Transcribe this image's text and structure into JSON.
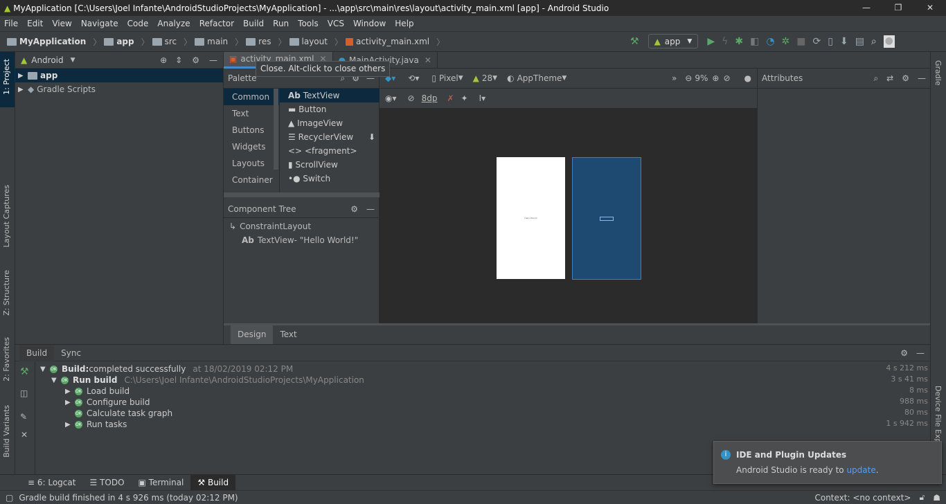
{
  "window": {
    "title": "MyApplication [C:\\Users\\Joel Infante\\AndroidStudioProjects\\MyApplication] - ...\\app\\src\\main\\res\\layout\\activity_main.xml [app] - Android Studio",
    "minimize": "—",
    "maximize": "❐",
    "close": "✕"
  },
  "menu": [
    "File",
    "Edit",
    "View",
    "Navigate",
    "Code",
    "Analyze",
    "Refactor",
    "Build",
    "Run",
    "Tools",
    "VCS",
    "Window",
    "Help"
  ],
  "breadcrumb": [
    "MyApplication",
    "app",
    "src",
    "main",
    "res",
    "layout",
    "activity_main.xml"
  ],
  "toolbar": {
    "run_config": "app"
  },
  "project": {
    "view": "Android",
    "items": [
      {
        "label": "app"
      },
      {
        "label": "Gradle Scripts"
      }
    ]
  },
  "left_strip": {
    "project": "1: Project",
    "captures": "Layout Captures",
    "structure": "Z: Structure",
    "favorites": "2: Favorites",
    "variants": "Build Variants"
  },
  "right_strip": {
    "gradle": "Gradle",
    "device": "Device File Explorer"
  },
  "editor_tabs": [
    {
      "label": "activity_main.xml",
      "active": true
    },
    {
      "label": "MainActivity.java",
      "active": false
    }
  ],
  "tooltip": "Close. Alt-click to close others",
  "palette": {
    "title": "Palette",
    "categories": [
      "Common",
      "Text",
      "Buttons",
      "Widgets",
      "Layouts",
      "Container"
    ],
    "items": [
      {
        "icon": "Ab",
        "label": "TextView"
      },
      {
        "icon": "▬",
        "label": "Button"
      },
      {
        "icon": "▲",
        "label": "ImageView"
      },
      {
        "icon": "☰",
        "label": "RecyclerView"
      },
      {
        "icon": "<>",
        "label": "<fragment>"
      },
      {
        "icon": "▮",
        "label": "ScrollView"
      },
      {
        "icon": "•●",
        "label": "Switch"
      }
    ]
  },
  "component_tree": {
    "title": "Component Tree",
    "root": "ConstraintLayout",
    "child_icon": "Ab",
    "child": "TextView- \"Hello World!\""
  },
  "design_toolbar": {
    "device": "Pixel",
    "api": "28",
    "theme": "AppTheme",
    "zoom": "9%",
    "margin": "8dp",
    "preview_text": "Hello World!"
  },
  "attributes": {
    "title": "Attributes"
  },
  "design_tabs": [
    {
      "label": "Design",
      "active": true
    },
    {
      "label": "Text",
      "active": false
    }
  ],
  "build": {
    "tabs": [
      "Build",
      "Sync"
    ],
    "rows": [
      {
        "bold": "Build:",
        "label": " completed successfully",
        "extra": "at 18/02/2019 02:12 PM",
        "time": "4 s 212 ms",
        "expand": "▼"
      },
      {
        "bold": "Run build",
        "label": "",
        "extra": "C:\\Users\\Joel Infante\\AndroidStudioProjects\\MyApplication",
        "time": "3 s 41 ms",
        "expand": "▼"
      },
      {
        "bold": "",
        "label": "Load build",
        "extra": "",
        "time": "8 ms",
        "expand": "▶"
      },
      {
        "bold": "",
        "label": "Configure build",
        "extra": "",
        "time": "988 ms",
        "expand": "▶"
      },
      {
        "bold": "",
        "label": "Calculate task graph",
        "extra": "",
        "time": "80 ms",
        "expand": ""
      },
      {
        "bold": "",
        "label": "Run tasks",
        "extra": "",
        "time": "1 s 942 ms",
        "expand": "▶"
      }
    ]
  },
  "bottom_tabs": [
    {
      "label": "6: Logcat"
    },
    {
      "label": "TODO"
    },
    {
      "label": "Terminal"
    },
    {
      "label": "Build",
      "active": true
    }
  ],
  "status": {
    "message": "Gradle build finished in 4 s 926 ms (today 02:12 PM)",
    "context": "Context: <no context>"
  },
  "notification": {
    "title": "IDE and Plugin Updates",
    "text": "Android Studio is ready to ",
    "link": "update",
    "end": "."
  },
  "colors": {
    "accent": "#4a88c7",
    "selection": "#0d293e",
    "android_green": "#a4c639",
    "ok_green": "#59a869",
    "blueprint": "#1e4a72"
  }
}
